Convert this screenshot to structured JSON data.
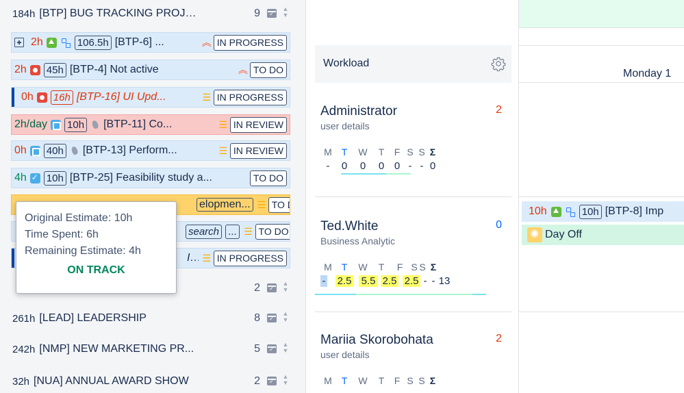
{
  "projects": [
    {
      "hours": "184h",
      "name": "[BTP] BUG TRACKING PROJE...",
      "count": "9"
    },
    {
      "hours": "",
      "name": "",
      "count": "2"
    },
    {
      "hours": "261h",
      "name": "[LEAD] LEADERSHIP",
      "count": "8"
    },
    {
      "hours": "242h",
      "name": "[NMP] NEW MARKETING PR...",
      "count": "5"
    },
    {
      "hours": "32h",
      "name": "[NUA] ANNUAL AWARD SHOW",
      "count": "2"
    }
  ],
  "tasks": [
    {
      "time": "2h",
      "estimate": "106.5h",
      "title": "[BTP-6] ...",
      "status": "IN PROGRESS"
    },
    {
      "time": "2h",
      "estimate": "45h",
      "title": "[BTP-4] Not active",
      "status": "TO DO"
    },
    {
      "time": "0h",
      "estimate": "16h",
      "title": "[BTP-16] UI Upd...",
      "status": "IN PROGRESS"
    },
    {
      "time": "2h/day",
      "estimate": "10h",
      "title": "[BTP-11] Co...",
      "status": "IN REVIEW"
    },
    {
      "time": "0h",
      "estimate": "40h",
      "title": "[BTP-13] Perform...",
      "status": "IN REVIEW"
    },
    {
      "time": "4h",
      "estimate": "10h",
      "title": "[BTP-25] Feasibility study a...",
      "status": "TO DO"
    },
    {
      "time": "",
      "estimate": "",
      "title": "elopmen...",
      "status": "TO DO"
    },
    {
      "time": "",
      "estimate": "search",
      "title": "...",
      "status": "TO DO"
    },
    {
      "time": "",
      "estimate": "",
      "title": "I...",
      "status": "IN PROGRESS"
    }
  ],
  "tooltip": {
    "original": "Original Estimate: 10h",
    "spent": "Time Spent: 6h",
    "remaining": "Remaining Estimate: 4h",
    "status": "ON TRACK"
  },
  "workload": {
    "title": "Workload",
    "days": [
      "M",
      "T",
      "W",
      "T",
      "F",
      "S",
      "S",
      "Σ"
    ],
    "users": [
      {
        "name": "Administrator",
        "role": "user details",
        "count": "2",
        "count_color": "#de350b",
        "values": [
          "-",
          "0",
          "0",
          "0",
          "0",
          "-",
          "-",
          "0"
        ]
      },
      {
        "name": "Ted.White",
        "role": "Business Analytic",
        "count": "0",
        "count_color": "#0065ff",
        "values": [
          "-",
          "2.5",
          "5.5",
          "2.5",
          "2.5",
          "-",
          "-",
          "13"
        ]
      },
      {
        "name": "Mariia Skorobohata",
        "role": "user details",
        "count": "2",
        "count_color": "#de350b",
        "values": []
      }
    ]
  },
  "calendar": {
    "day_label": "Monday 1",
    "task": {
      "time": "10h",
      "estimate": "10h",
      "title": "[BTP-8] Imp"
    },
    "day_off": "Day Off"
  }
}
